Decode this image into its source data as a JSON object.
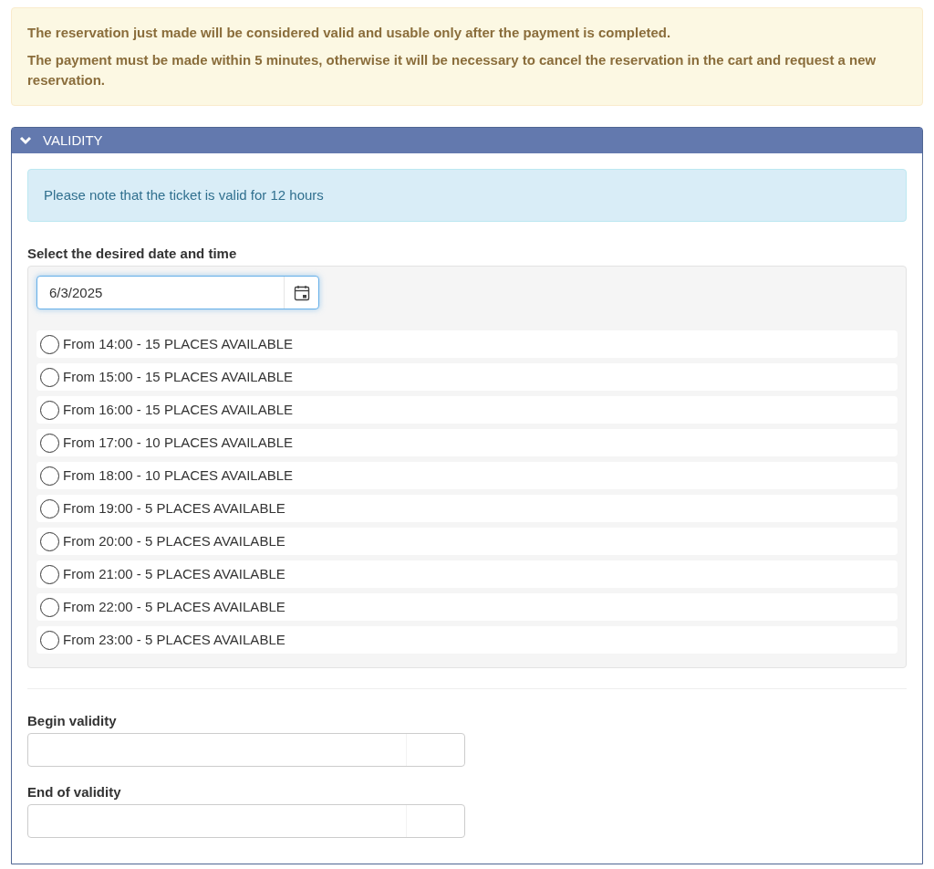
{
  "warning": {
    "lines": [
      "The reservation just made will be considered valid and usable only after the payment is completed.",
      "The payment must be made within 5 minutes, otherwise it will be necessary to cancel the reservation in the cart and request a new reservation."
    ]
  },
  "panel": {
    "title": "VALIDITY",
    "expanded": true,
    "info": "Please note that the ticket is valid for 12 hours",
    "date_label": "Select the desired date and time",
    "date_field": {
      "value": "6/3/2025"
    },
    "slots": [
      {
        "label": "From 14:00 - 15 PLACES AVAILABLE",
        "selected": false
      },
      {
        "label": "From 15:00 - 15 PLACES AVAILABLE",
        "selected": false
      },
      {
        "label": "From 16:00 - 15 PLACES AVAILABLE",
        "selected": false
      },
      {
        "label": "From 17:00 - 10 PLACES AVAILABLE",
        "selected": false
      },
      {
        "label": "From 18:00 - 10 PLACES AVAILABLE",
        "selected": false
      },
      {
        "label": "From 19:00 - 5 PLACES AVAILABLE",
        "selected": false
      },
      {
        "label": "From 20:00 - 5 PLACES AVAILABLE",
        "selected": false
      },
      {
        "label": "From 21:00 - 5 PLACES AVAILABLE",
        "selected": false
      },
      {
        "label": "From 22:00 - 5 PLACES AVAILABLE",
        "selected": false
      },
      {
        "label": "From 23:00 - 5 PLACES AVAILABLE",
        "selected": false
      }
    ],
    "fields": [
      {
        "label": "Begin validity"
      },
      {
        "label": "End of validity"
      }
    ]
  }
}
